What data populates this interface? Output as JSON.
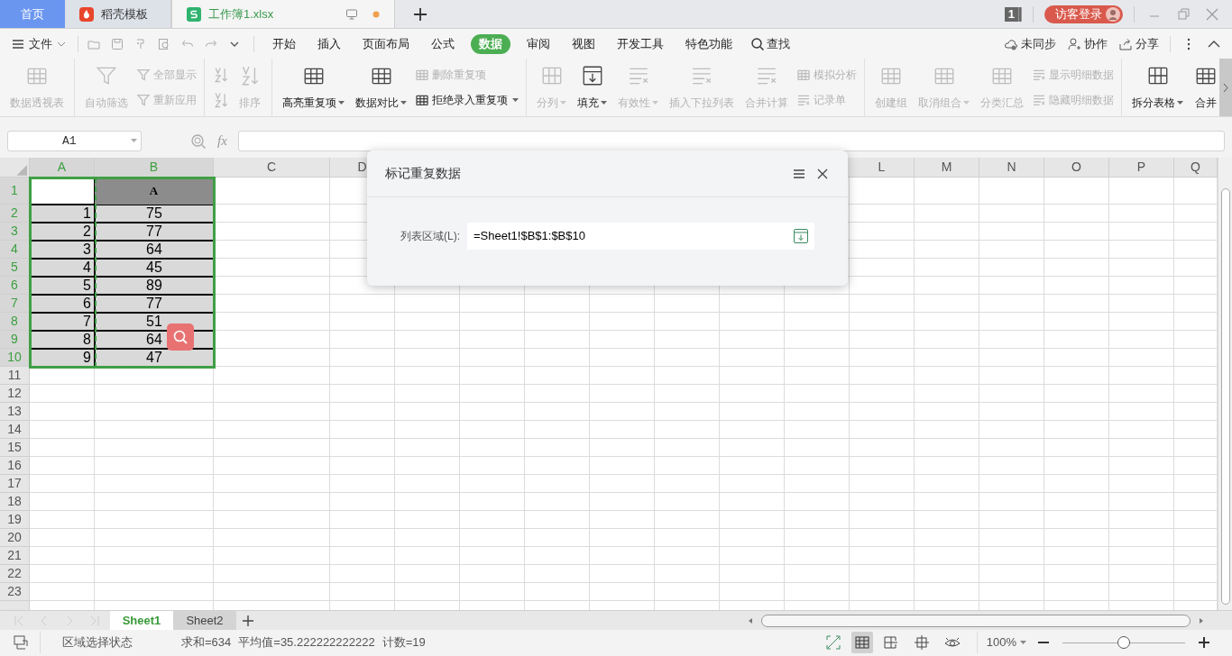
{
  "tabs": [
    {
      "label": "首页",
      "kind": "home",
      "selected": false
    },
    {
      "label": "稻壳模板",
      "kind": "docer",
      "selected": false
    },
    {
      "label": "工作簿1.xlsx",
      "kind": "sheet",
      "selected": true
    }
  ],
  "title_bar": {
    "badge": "1",
    "login": "访客登录"
  },
  "menu": {
    "file": "文件",
    "tabs": [
      {
        "label": "开始",
        "selected": false
      },
      {
        "label": "插入",
        "selected": false
      },
      {
        "label": "页面布局",
        "selected": false
      },
      {
        "label": "公式",
        "selected": false
      },
      {
        "label": "数据",
        "selected": true
      },
      {
        "label": "审阅",
        "selected": false
      },
      {
        "label": "视图",
        "selected": false
      },
      {
        "label": "开发工具",
        "selected": false
      },
      {
        "label": "特色功能",
        "selected": false
      }
    ],
    "search": "查找",
    "actions": [
      "未同步",
      "协作",
      "分享"
    ]
  },
  "ribbon": {
    "groups": [
      {
        "items": [
          {
            "kind": "large",
            "label": "数据透视表",
            "disabled": true,
            "dropdown": false
          }
        ]
      },
      {
        "items": [
          {
            "kind": "large",
            "label": "自动筛选",
            "disabled": true,
            "dropdown": false
          },
          {
            "kind": "stack",
            "items": [
              {
                "label": "全部显示",
                "disabled": true,
                "dropdown": false
              },
              {
                "label": "重新应用",
                "disabled": true,
                "dropdown": false
              }
            ]
          }
        ]
      },
      {
        "items": [
          {
            "kind": "icon_stack",
            "disabled": true
          },
          {
            "kind": "large",
            "label": "排序",
            "disabled": true,
            "dropdown": false
          }
        ]
      },
      {
        "items": [
          {
            "kind": "large",
            "label": "高亮重复项",
            "disabled": false,
            "dropdown": true
          },
          {
            "kind": "large",
            "label": "数据对比",
            "disabled": false,
            "dropdown": true
          },
          {
            "kind": "stack",
            "items": [
              {
                "label": "删除重复项",
                "disabled": true,
                "dropdown": false
              },
              {
                "label": "拒绝录入重复项",
                "disabled": false,
                "dropdown": true
              }
            ]
          }
        ]
      },
      {
        "items": [
          {
            "kind": "large",
            "label": "分列",
            "disabled": true,
            "dropdown": true
          },
          {
            "kind": "large",
            "label": "填充",
            "disabled": false,
            "dropdown": true
          },
          {
            "kind": "large",
            "label": "有效性",
            "disabled": true,
            "dropdown": true
          },
          {
            "kind": "large",
            "label": "插入下拉列表",
            "disabled": true,
            "dropdown": false
          },
          {
            "kind": "large",
            "label": "合并计算",
            "disabled": true,
            "dropdown": false
          },
          {
            "kind": "stack",
            "items": [
              {
                "label": "模拟分析",
                "disabled": true,
                "dropdown": false
              },
              {
                "label": "记录单",
                "disabled": true,
                "dropdown": false
              }
            ]
          }
        ]
      },
      {
        "items": [
          {
            "kind": "large",
            "label": "创建组",
            "disabled": true,
            "dropdown": false
          },
          {
            "kind": "large",
            "label": "取消组合",
            "disabled": true,
            "dropdown": true
          },
          {
            "kind": "large",
            "label": "分类汇总",
            "disabled": true,
            "dropdown": false
          },
          {
            "kind": "stack",
            "items": [
              {
                "label": "显示明细数据",
                "disabled": true,
                "dropdown": false
              },
              {
                "label": "隐藏明细数据",
                "disabled": true,
                "dropdown": false
              }
            ]
          }
        ]
      },
      {
        "items": [
          {
            "kind": "large",
            "label": "拆分表格",
            "disabled": false,
            "dropdown": true
          },
          {
            "kind": "large",
            "label": "合并",
            "disabled": false,
            "dropdown": false
          }
        ]
      }
    ]
  },
  "formula_bar": {
    "name_box": "A1",
    "fx": "fx"
  },
  "columns": [
    {
      "label": "A",
      "selected": true,
      "marquee": false
    },
    {
      "label": "B",
      "selected": true,
      "marquee": true
    },
    {
      "label": "C",
      "selected": false,
      "marquee": false
    },
    {
      "label": "D",
      "selected": false,
      "marquee": false
    },
    {
      "label": "L",
      "selected": false,
      "marquee": false
    },
    {
      "label": "M",
      "selected": false,
      "marquee": false
    },
    {
      "label": "N",
      "selected": false,
      "marquee": false
    },
    {
      "label": "O",
      "selected": false,
      "marquee": false
    },
    {
      "label": "P",
      "selected": false,
      "marquee": false
    },
    {
      "label": "Q",
      "selected": false,
      "marquee": false
    }
  ],
  "rows": [
    {
      "label": "1",
      "selected": true,
      "cells": [
        {
          "kind": "blank"
        },
        {
          "kind": "title",
          "text": "A"
        }
      ]
    },
    {
      "label": "2",
      "selected": true,
      "cells": [
        {
          "kind": "number",
          "text": "1"
        },
        {
          "kind": "value",
          "text": "75"
        }
      ]
    },
    {
      "label": "3",
      "selected": true,
      "cells": [
        {
          "kind": "number",
          "text": "2"
        },
        {
          "kind": "value",
          "text": "77"
        }
      ]
    },
    {
      "label": "4",
      "selected": true,
      "cells": [
        {
          "kind": "number",
          "text": "3"
        },
        {
          "kind": "value",
          "text": "64"
        }
      ]
    },
    {
      "label": "5",
      "selected": true,
      "cells": [
        {
          "kind": "number",
          "text": "4"
        },
        {
          "kind": "value",
          "text": "45"
        }
      ]
    },
    {
      "label": "6",
      "selected": true,
      "cells": [
        {
          "kind": "number",
          "text": "5"
        },
        {
          "kind": "value",
          "text": "89"
        }
      ]
    },
    {
      "label": "7",
      "selected": true,
      "cells": [
        {
          "kind": "number",
          "text": "6"
        },
        {
          "kind": "value",
          "text": "77"
        }
      ]
    },
    {
      "label": "8",
      "selected": true,
      "cells": [
        {
          "kind": "number",
          "text": "7"
        },
        {
          "kind": "value",
          "text": "51"
        }
      ]
    },
    {
      "label": "9",
      "selected": true,
      "cells": [
        {
          "kind": "number",
          "text": "8"
        },
        {
          "kind": "value",
          "text": "64"
        }
      ]
    },
    {
      "label": "10",
      "selected": true,
      "cells": [
        {
          "kind": "number",
          "text": "9"
        },
        {
          "kind": "value",
          "text": "47"
        }
      ]
    },
    {
      "label": "11",
      "selected": false
    },
    {
      "label": "12",
      "selected": false
    },
    {
      "label": "13",
      "selected": false
    },
    {
      "label": "14",
      "selected": false
    },
    {
      "label": "15",
      "selected": false
    },
    {
      "label": "16",
      "selected": false
    },
    {
      "label": "17",
      "selected": false
    },
    {
      "label": "18",
      "selected": false
    },
    {
      "label": "19",
      "selected": false
    },
    {
      "label": "20",
      "selected": false
    },
    {
      "label": "21",
      "selected": false
    },
    {
      "label": "22",
      "selected": false
    },
    {
      "label": "23",
      "selected": false
    }
  ],
  "dialog": {
    "title": "标记重复数据",
    "field_label": "列表区域(L):",
    "field_value": "=Sheet1!$B$1:$B$10"
  },
  "sheets": [
    {
      "label": "Sheet1",
      "selected": true
    },
    {
      "label": "Sheet2",
      "selected": false
    }
  ],
  "status_bar": {
    "mode": "区域选择状态",
    "stats": [
      "求和=634",
      "平均值=35.222222222222",
      "计数=19"
    ],
    "zoom": "100%",
    "zoom_level": {
      "level": 0.5
    }
  }
}
